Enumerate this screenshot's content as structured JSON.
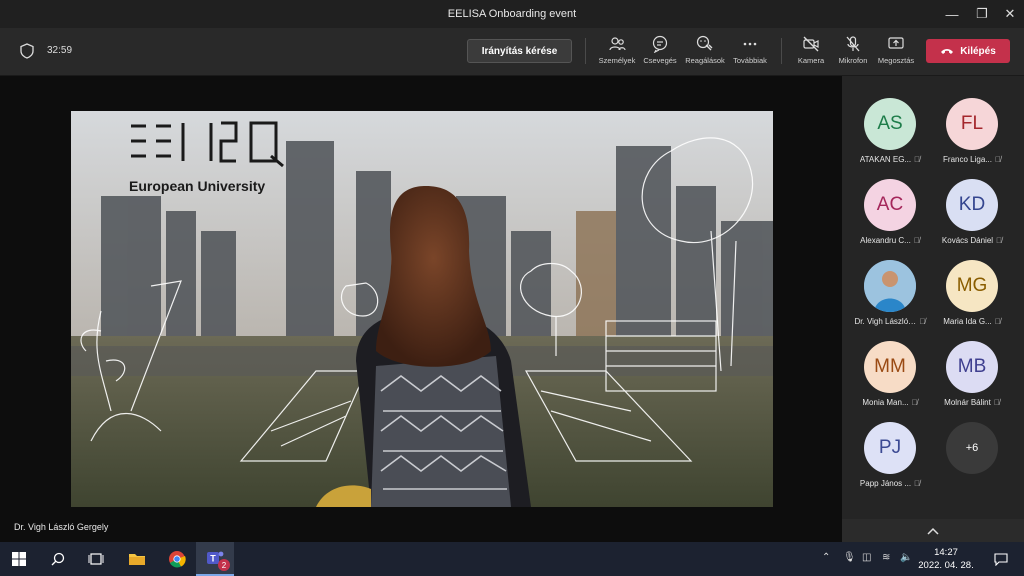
{
  "window": {
    "title": "EELISA Onboarding event"
  },
  "toolbar": {
    "timer": "32:59",
    "request_control": "Irányítás kérése",
    "people": "Személyek",
    "chat": "Csevegés",
    "reactions": "Reagálások",
    "more": "Továbbiak",
    "camera": "Kamera",
    "mic": "Mikrofon",
    "share": "Megosztás",
    "leave": "Kilépés"
  },
  "slide": {
    "logo_text": "EELISA",
    "subtitle": "European University"
  },
  "presenter_name": "Dr. Vigh László Gergely",
  "participants": [
    {
      "initials": "AS",
      "name": "ATAKAN EG...",
      "bg": "#c9e7d6",
      "fg": "#1e7d4a"
    },
    {
      "initials": "FL",
      "name": "Franco Liga...",
      "bg": "#f6d6d8",
      "fg": "#a4262c"
    },
    {
      "initials": "AC",
      "name": "Alexandru C...",
      "bg": "#f4d3e2",
      "fg": "#a4265a"
    },
    {
      "initials": "KD",
      "name": "Kovács Dániel",
      "bg": "#d9dff3",
      "fg": "#34458f"
    },
    {
      "initials": "",
      "name": "Dr. Vigh László ...",
      "bg": "#5f8fb8",
      "fg": "#fff"
    },
    {
      "initials": "MG",
      "name": "Maria Ida G...",
      "bg": "#f6e6c3",
      "fg": "#8a5d00"
    },
    {
      "initials": "MM",
      "name": "Monia Man...",
      "bg": "#f7dcc6",
      "fg": "#9a4a13"
    },
    {
      "initials": "MB",
      "name": "Molnár Bálint",
      "bg": "#dcdcf3",
      "fg": "#3f3f8f"
    },
    {
      "initials": "PJ",
      "name": "Papp János ...",
      "bg": "#dde1f6",
      "fg": "#3c4a93"
    }
  ],
  "overflow_count": "+6",
  "taskbar": {
    "time": "14:27",
    "date": "2022. 04. 28.",
    "teams_badge": "2"
  }
}
